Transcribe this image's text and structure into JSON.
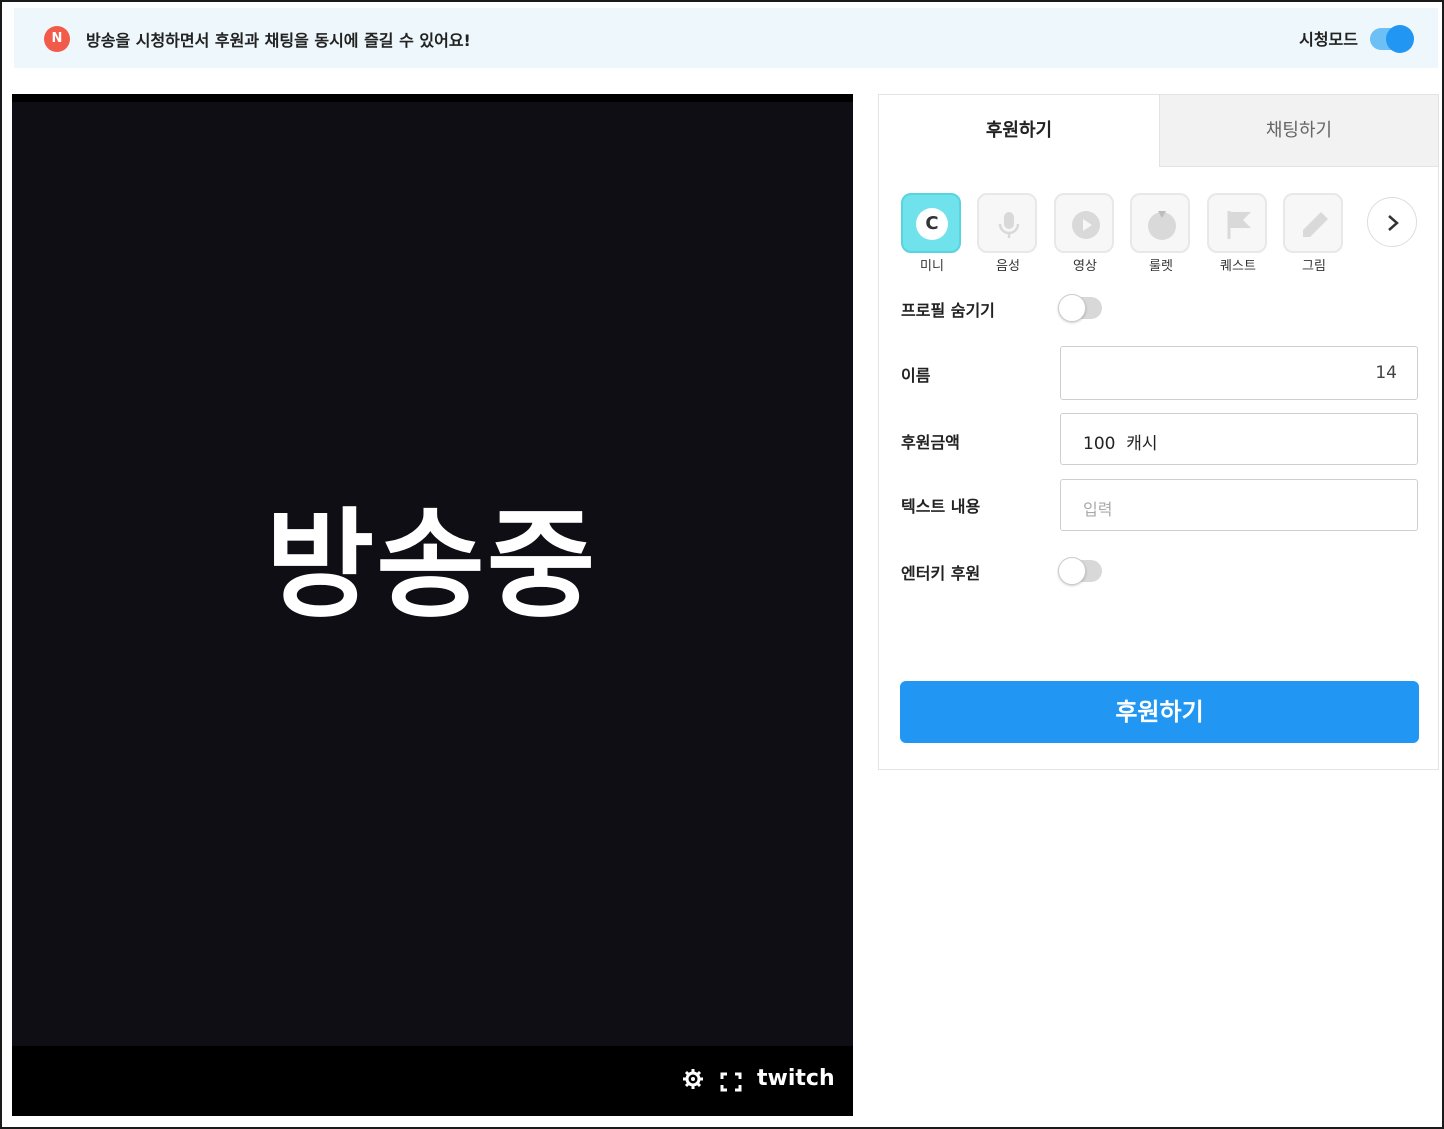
{
  "notice": {
    "badge": "N",
    "text": "방송을 시청하면서 후원과 채팅을 동시에 즐길 수 있어요!",
    "mode_label": "시청모드",
    "mode_enabled": true
  },
  "player": {
    "overlay_text": "방송중",
    "brand": "twitch"
  },
  "panel": {
    "tabs": [
      {
        "label": "후원하기",
        "active": true
      },
      {
        "label": "채팅하기",
        "active": false
      }
    ],
    "donation_types": [
      {
        "label": "미니",
        "icon": "coin-icon",
        "active": true
      },
      {
        "label": "음성",
        "icon": "microphone-icon",
        "active": false
      },
      {
        "label": "영상",
        "icon": "play-icon",
        "active": false
      },
      {
        "label": "룰렛",
        "icon": "roulette-icon",
        "active": false
      },
      {
        "label": "퀘스트",
        "icon": "flag-icon",
        "active": false
      },
      {
        "label": "그림",
        "icon": "pencil-icon",
        "active": false
      }
    ],
    "coin_symbol": "C",
    "hide_profile": {
      "label": "프로필 숨기기",
      "enabled": false
    },
    "name": {
      "label": "이름",
      "value": "14"
    },
    "amount": {
      "label": "후원금액",
      "value": "100  캐시"
    },
    "message": {
      "label": "텍스트 내용",
      "placeholder": "입력"
    },
    "enter_key": {
      "label": "엔터키 후원",
      "enabled": false
    },
    "submit_label": "후원하기"
  },
  "colors": {
    "accent": "#2196f3",
    "notice_bg": "#eef8fc",
    "badge": "#f25a4a",
    "active_tile": "#6fe2ec"
  }
}
